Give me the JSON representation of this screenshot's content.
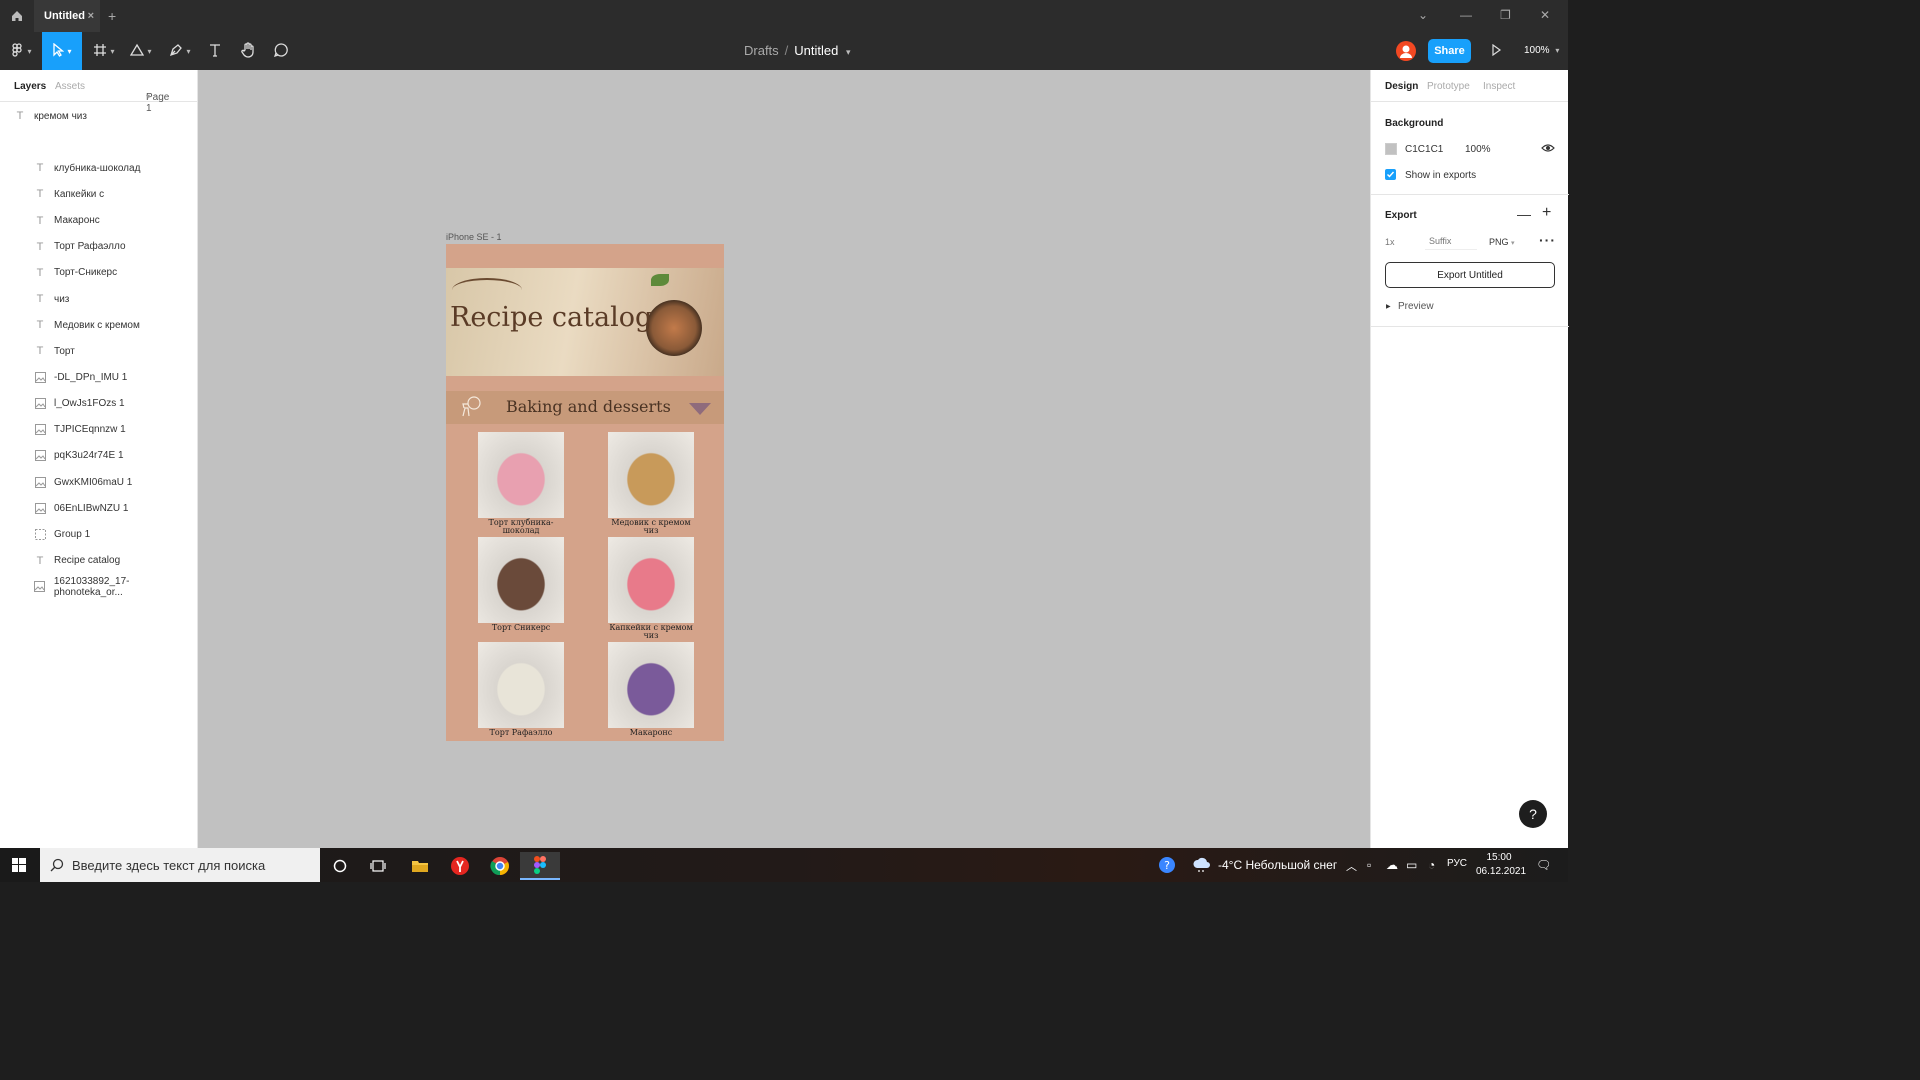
{
  "window": {
    "tab_title": "Untitled",
    "tab_close": "×",
    "new_tab": "+"
  },
  "toolbar": {
    "breadcrumb_drafts": "Drafts",
    "breadcrumb_sep": "/",
    "file_name": "Untitled",
    "share_label": "Share",
    "zoom": "100%"
  },
  "left_panel": {
    "tabs": [
      "Layers",
      "Assets"
    ],
    "page": "Page 1",
    "layers": [
      {
        "type": "text",
        "name": "кремом чиз",
        "indent": 0
      },
      {
        "type": "frame",
        "name": "iPhone SE - 1",
        "indent": 0
      },
      {
        "type": "text",
        "name": "клубника-шоколад",
        "indent": 1
      },
      {
        "type": "text",
        "name": "Капкейки с",
        "indent": 1
      },
      {
        "type": "text",
        "name": "Макаронс",
        "indent": 1
      },
      {
        "type": "text",
        "name": "Торт Рафаэлло",
        "indent": 1
      },
      {
        "type": "text",
        "name": "Торт-Сникерс",
        "indent": 1
      },
      {
        "type": "text",
        "name": "чиз",
        "indent": 1
      },
      {
        "type": "text",
        "name": "Медовик с кремом",
        "indent": 1
      },
      {
        "type": "text",
        "name": "Торт",
        "indent": 1
      },
      {
        "type": "image",
        "name": "-DL_DPn_IMU 1",
        "indent": 1
      },
      {
        "type": "image",
        "name": "l_OwJs1FOzs 1",
        "indent": 1
      },
      {
        "type": "image",
        "name": "TJPICEqnnzw 1",
        "indent": 1
      },
      {
        "type": "image",
        "name": "pqK3u24r74E 1",
        "indent": 1
      },
      {
        "type": "image",
        "name": "GwxKMI06maU 1",
        "indent": 1
      },
      {
        "type": "image",
        "name": "06EnLIBwNZU 1",
        "indent": 1
      },
      {
        "type": "group",
        "name": "Group 1",
        "indent": 1
      },
      {
        "type": "text",
        "name": "Recipe catalog",
        "indent": 1
      },
      {
        "type": "image",
        "name": "1621033892_17-phonoteka_or...",
        "indent": 1
      }
    ]
  },
  "canvas": {
    "background": "#c1c1c1",
    "frame_label": "iPhone SE - 1",
    "hero_title": "Recipe catalog",
    "banner_title": "Baking and desserts",
    "cards": [
      {
        "caption": "Торт клубника-шоколад",
        "color": "#e8a0b0"
      },
      {
        "caption": "Медовик с кремом чиз",
        "color": "#c89a5a"
      },
      {
        "caption": "Торт Сникерс",
        "color": "#6a4a3a"
      },
      {
        "caption": "Капкейки с кремом чиз",
        "color": "#e87a8a"
      },
      {
        "caption": "Торт Рафаэлло",
        "color": "#e8e4d8"
      },
      {
        "caption": "Макаронс",
        "color": "#7a5a9a"
      }
    ]
  },
  "right_panel": {
    "tabs": [
      "Design",
      "Prototype",
      "Inspect"
    ],
    "background_title": "Background",
    "bg_hex": "C1C1C1",
    "bg_opacity": "100%",
    "show_in_exports": "Show in exports",
    "export_title": "Export",
    "export_scale": "1x",
    "export_suffix_placeholder": "Suffix",
    "export_format": "PNG",
    "export_button": "Export Untitled",
    "preview": "Preview",
    "help": "?"
  },
  "taskbar": {
    "search_placeholder": "Введите здесь текст для поиска",
    "weather": "-4°C  Небольшой снег",
    "lang": "РУС",
    "time": "15:00",
    "date": "06.12.2021"
  }
}
